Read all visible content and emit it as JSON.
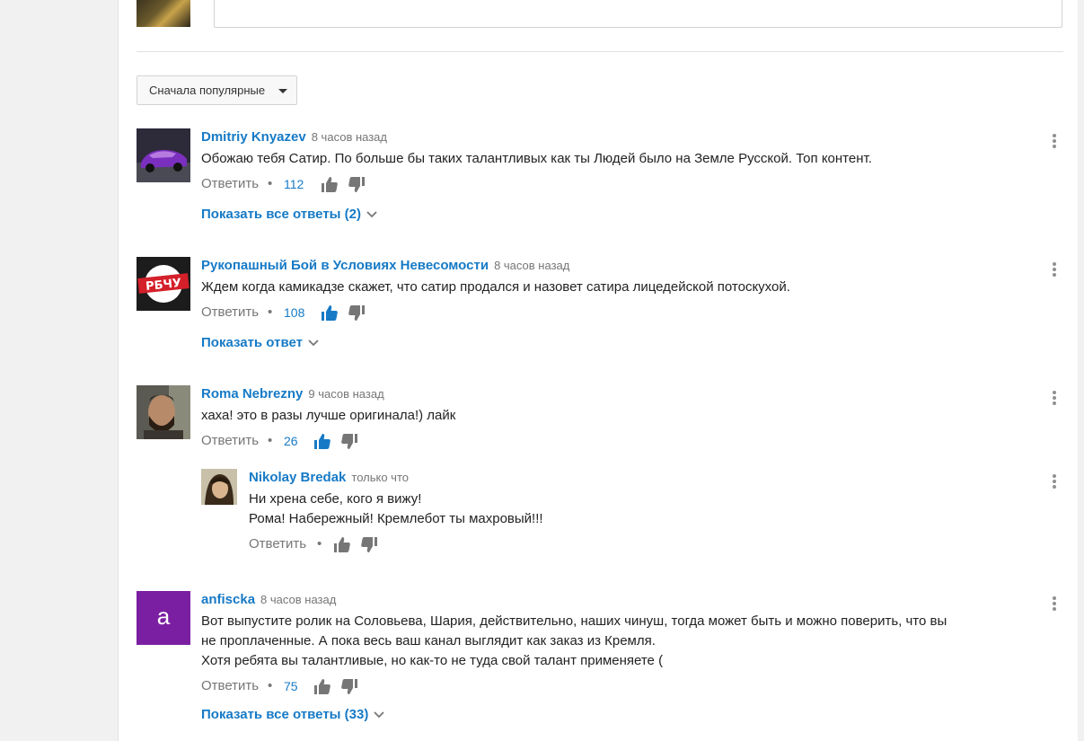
{
  "sort": {
    "label": "Сначала популярные"
  },
  "comments": [
    {
      "author": "Dmitriy Knyazev",
      "time": "8 часов назад",
      "text": "Обожаю тебя Сатир. По больше бы таких талантливых как ты Людей было на Земле Русской. Топ контент.",
      "reply_label": "Ответить",
      "likes": "112",
      "show_replies": "Показать все ответы (2)"
    },
    {
      "author": "Рукопашный Бой в Условиях Невесомости",
      "time": "8 часов назад",
      "text": "Ждем когда камикадзе скажет, что сатир продался и назовет сатира лицедейской потоскухой.",
      "reply_label": "Ответить",
      "likes": "108",
      "show_replies": "Показать ответ",
      "avatar_text": "РБЧУ"
    },
    {
      "author": "Roma Nebrezny",
      "time": "9 часов назад",
      "text": "хаха! это в разы лучше оригинала!) лайк",
      "reply_label": "Ответить",
      "likes": "26",
      "reply": {
        "author": "Nikolay Bredak",
        "time": "только что",
        "line1": "Ни хрена себе, кого я вижу!",
        "line2": "Рома! Набережный! Кремлебот ты махровый!!!",
        "reply_label": "Ответить"
      }
    },
    {
      "author": "anfiscka",
      "time": "8 часов назад",
      "avatar_letter": "a",
      "line1": "Вот выпустите ролик на Соловьева, Шария, действительно, наших чинуш, тогда может быть и можно поверить, что вы",
      "line2": "не проплаченные. А пока весь ваш канал выглядит как заказ из Кремля.",
      "line3": "Хотя ребята вы талантливые, но как-то не туда свой талант применяете (",
      "reply_label": "Ответить",
      "likes": "75",
      "show_replies": "Показать все ответы (33)"
    }
  ],
  "colors": {
    "link": "#167ac6",
    "muted": "#767676",
    "avatar_purple": "#7b1fa2"
  },
  "icons": [
    "thumb-up-icon",
    "thumb-down-icon",
    "chevron-down-icon",
    "more-vert-icon",
    "caret-down-icon"
  ]
}
